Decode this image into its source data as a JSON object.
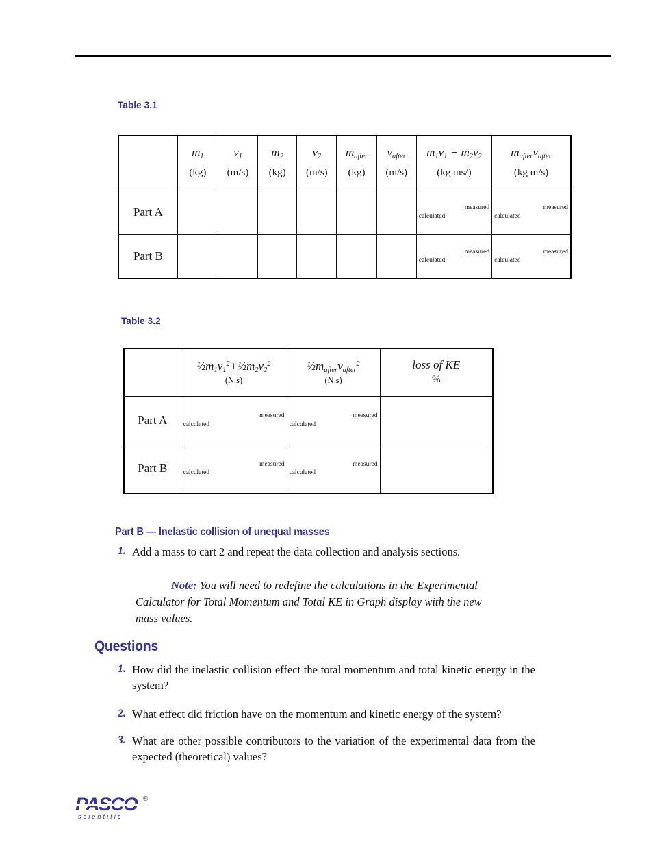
{
  "tables": {
    "t31": {
      "caption": "Table 3.1",
      "headers": [
        {
          "symbol": "",
          "unit": ""
        },
        {
          "symbol": "m_1",
          "unit": "(kg)"
        },
        {
          "symbol": "v_1",
          "unit": "(m/s)"
        },
        {
          "symbol": "m_2",
          "unit": "(kg)"
        },
        {
          "symbol": "v_2",
          "unit": "(m/s)"
        },
        {
          "symbol": "m_after",
          "unit": "(kg)"
        },
        {
          "symbol": "v_after",
          "unit": "(m/s)"
        },
        {
          "symbol": "m_1 v_1 + m_2 v_2",
          "unit": "(kg ms/)"
        },
        {
          "symbol": "m_after v_after",
          "unit": "(kg m/s)"
        }
      ],
      "rows": [
        {
          "label": "Part A"
        },
        {
          "label": "Part B"
        }
      ],
      "split_labels": {
        "calculated": "calculated",
        "measured": "measured"
      }
    },
    "t32": {
      "caption": "Table 3.2",
      "headers": [
        {
          "symbol": "",
          "unit": ""
        },
        {
          "symbol": "1/2 m_1 v_1^2 + 1/2 m_2 v_2^2",
          "unit": "(N s)"
        },
        {
          "symbol": "1/2 m_after v_after^2",
          "unit": "(N s)"
        },
        {
          "symbol": "loss of KE",
          "unit": "%"
        }
      ],
      "rows": [
        {
          "label": "Part A"
        },
        {
          "label": "Part B"
        }
      ],
      "split_labels": {
        "calculated": "calculated",
        "measured": "measured"
      }
    }
  },
  "part_b": {
    "heading": "Part B — Inelastic collision of unequal masses",
    "steps": [
      {
        "number": "1.",
        "text": "Add a mass to cart 2 and repeat the data collection and analysis sections."
      }
    ],
    "note": {
      "label": "Note:",
      "text": " You will need to redefine the calculations in the Experimental Calculator for Total Momentum and Total KE in Graph display with the new mass values."
    }
  },
  "questions": {
    "heading": "Questions",
    "items": [
      {
        "number": "1.",
        "text": "How did the inelastic collision effect the total momentum and total kinetic energy in the system?"
      },
      {
        "number": "2.",
        "text": "What effect did friction have on the momentum and kinetic energy of the system?"
      },
      {
        "number": "3.",
        "text": "What are other possible contributors to the variation of the experimental data from the expected (theoretical) values?"
      }
    ]
  },
  "logo": {
    "wordmark": "PASCO",
    "registered": "®",
    "subword": "scientific"
  },
  "colors": {
    "accent_blue": "#333399",
    "text_black": "#111111",
    "rule_black": "#000000"
  }
}
